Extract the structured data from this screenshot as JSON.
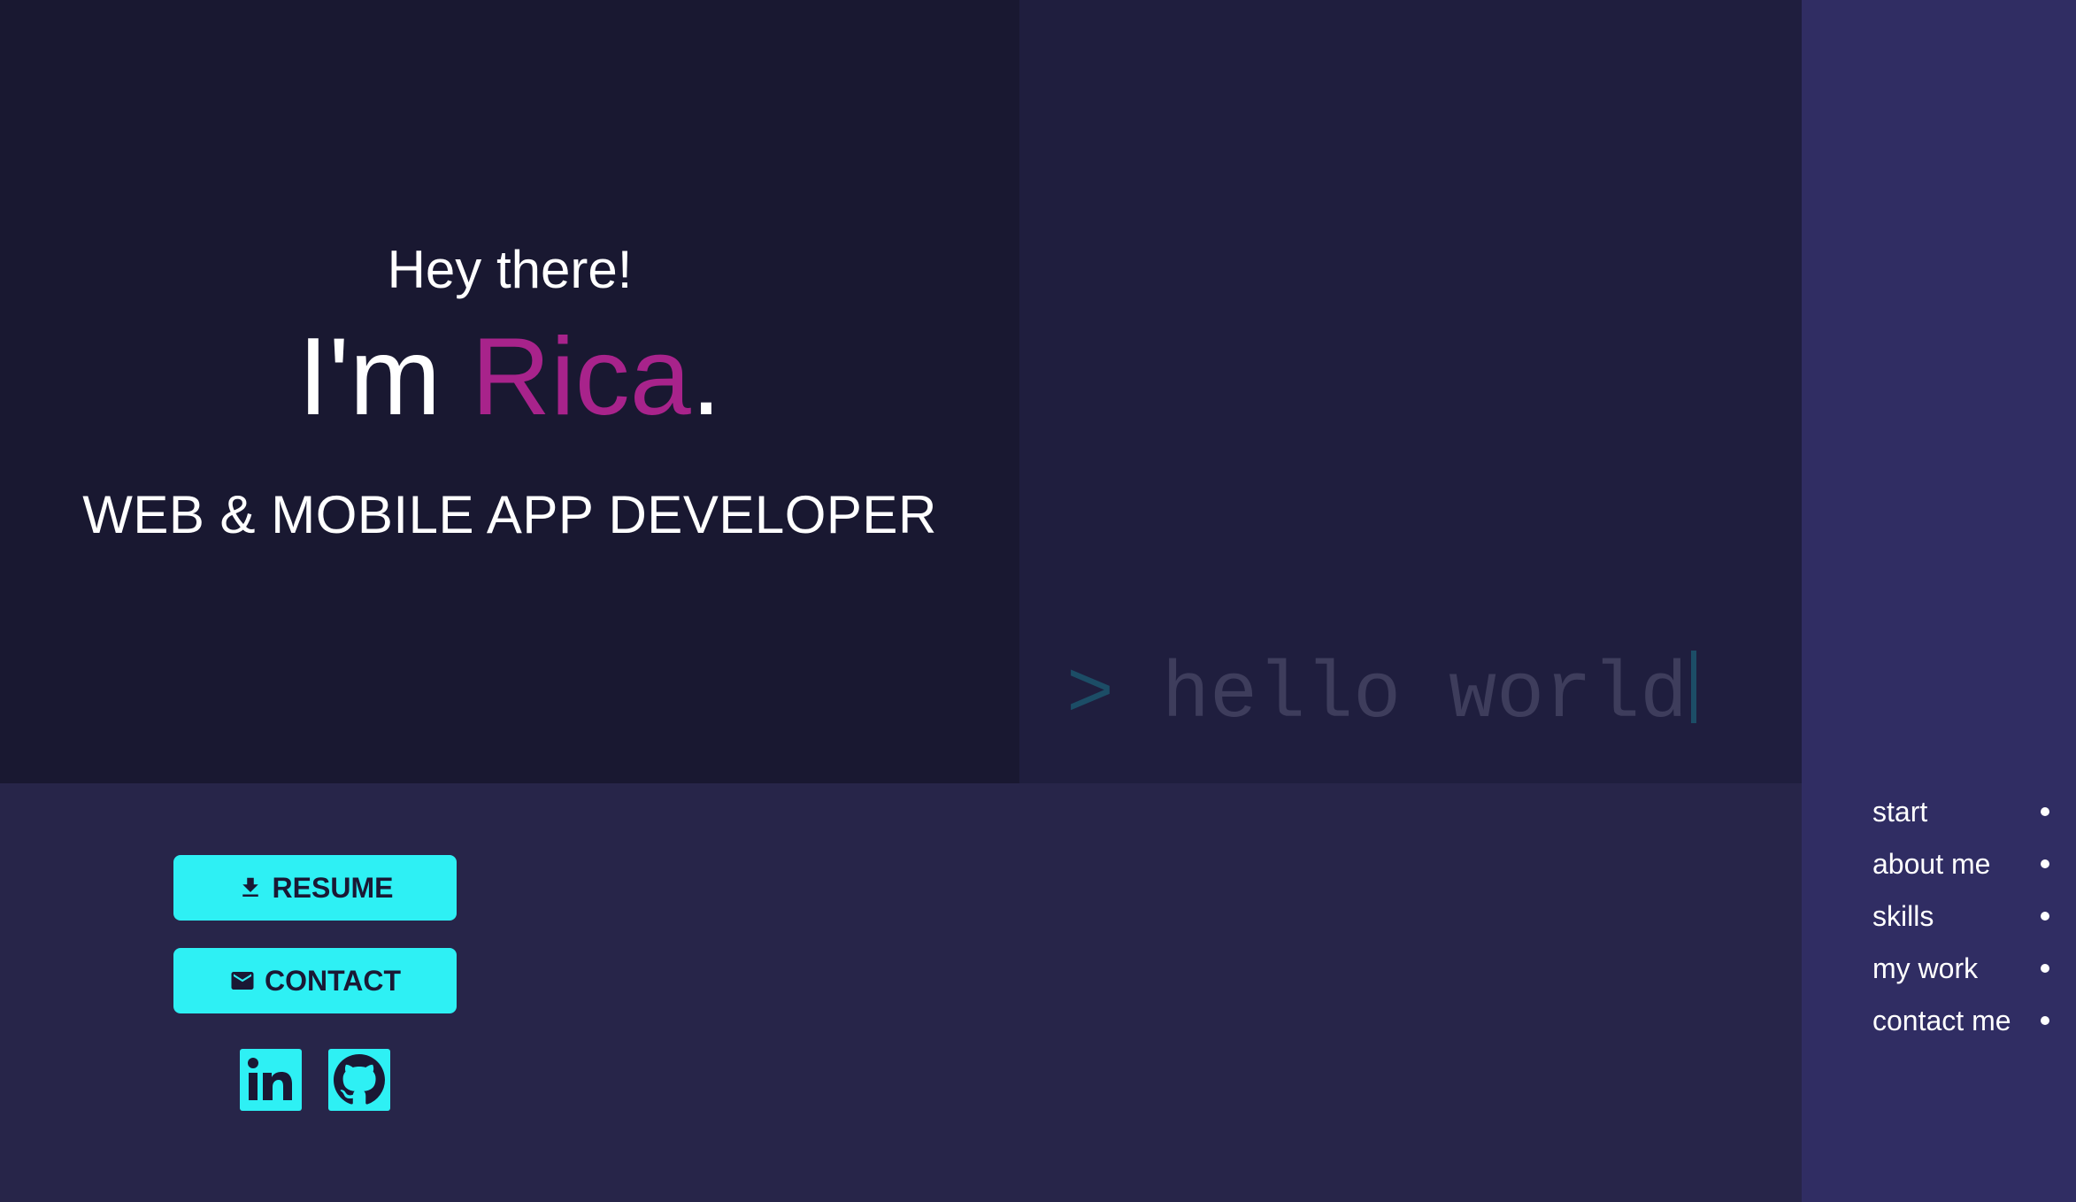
{
  "hero": {
    "greeting": "Hey there!",
    "intro_prefix": "I'm ",
    "name": "Rica",
    "intro_suffix": ".",
    "role": "WEB & MOBILE APP DEVELOPER"
  },
  "terminal": {
    "prompt": ">",
    "text": "hello world"
  },
  "actions": {
    "resume_label": "RESUME",
    "contact_label": "CONTACT"
  },
  "social": [
    {
      "name": "LinkedIn",
      "icon": "linkedin-icon"
    },
    {
      "name": "GitHub",
      "icon": "github-icon"
    }
  ],
  "nav": {
    "items": [
      {
        "label": "start"
      },
      {
        "label": "about me"
      },
      {
        "label": "skills"
      },
      {
        "label": "my work"
      },
      {
        "label": "contact me"
      }
    ]
  },
  "colors": {
    "accent_cyan": "#2ef0f4",
    "accent_magenta": "#a8238b",
    "hero_bg": "#191831",
    "lower_bg": "#272549",
    "nav_bg": "#302d63"
  }
}
